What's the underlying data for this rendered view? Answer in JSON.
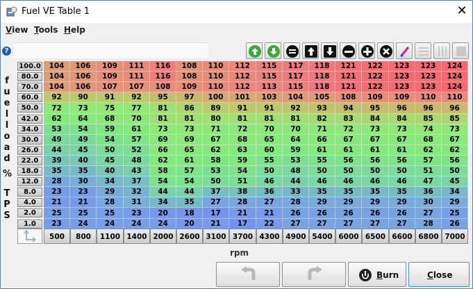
{
  "window": {
    "title": "Fuel VE Table 1",
    "close_glyph": "✕"
  },
  "menu": [
    {
      "label": "View",
      "ul": "V",
      "rest": "iew"
    },
    {
      "label": "Tools",
      "ul": "T",
      "rest": "ools"
    },
    {
      "label": "Help",
      "ul": "H",
      "rest": "elp"
    }
  ],
  "help_glyph": "?",
  "toolbar": {
    "buttons": [
      "increment-icon",
      "decrement-icon",
      "set-value-icon",
      "shift-up-icon",
      "shift-down-icon",
      "subtract-icon",
      "add-icon",
      "multiply-icon",
      "pen-icon",
      "vertical-interpolate-icon",
      "horizontal-interpolate-icon",
      "fill-icon"
    ]
  },
  "side_label": {
    "top": [
      "f",
      "u",
      "e",
      "l",
      "l",
      "o",
      "a",
      "d"
    ],
    "mid": "%",
    "bottom": [
      "T",
      "P",
      "S"
    ]
  },
  "table": {
    "y_axis": [
      "100.0",
      "80.0",
      "70.0",
      "60.0",
      "50.0",
      "42.0",
      "34.0",
      "30.0",
      "26.0",
      "22.0",
      "18.0",
      "12.0",
      "8.0",
      "4.0",
      "2.0",
      "1.0"
    ],
    "x_axis": [
      "500",
      "800",
      "1100",
      "1400",
      "2000",
      "2600",
      "3100",
      "3700",
      "4300",
      "4900",
      "5400",
      "6000",
      "6500",
      "6600",
      "6800",
      "7000"
    ],
    "x_axis_title": "rpm",
    "rows": [
      [
        104,
        106,
        109,
        111,
        116,
        108,
        110,
        112,
        115,
        117,
        118,
        121,
        122,
        123,
        123,
        124
      ],
      [
        104,
        106,
        109,
        111,
        116,
        108,
        110,
        112,
        115,
        117,
        118,
        121,
        122,
        123,
        123,
        124
      ],
      [
        104,
        106,
        107,
        107,
        108,
        109,
        110,
        112,
        113,
        115,
        118,
        121,
        122,
        123,
        123,
        124
      ],
      [
        92,
        90,
        91,
        92,
        95,
        97,
        100,
        101,
        103,
        104,
        105,
        108,
        109,
        109,
        110,
        110
      ],
      [
        72,
        73,
        75,
        77,
        81,
        86,
        89,
        91,
        91,
        92,
        93,
        94,
        95,
        96,
        96,
        96
      ],
      [
        62,
        64,
        68,
        70,
        81,
        81,
        80,
        81,
        81,
        81,
        82,
        83,
        84,
        84,
        85,
        85
      ],
      [
        53,
        54,
        59,
        61,
        73,
        73,
        71,
        72,
        70,
        70,
        71,
        72,
        73,
        73,
        74,
        73
      ],
      [
        49,
        49,
        54,
        57,
        69,
        69,
        67,
        68,
        65,
        64,
        66,
        67,
        67,
        67,
        68,
        67
      ],
      [
        44,
        45,
        50,
        52,
        66,
        65,
        62,
        63,
        60,
        59,
        61,
        61,
        61,
        61,
        62,
        62
      ],
      [
        39,
        40,
        45,
        48,
        62,
        61,
        58,
        59,
        55,
        53,
        55,
        56,
        56,
        56,
        57,
        56
      ],
      [
        35,
        35,
        40,
        43,
        58,
        57,
        53,
        54,
        50,
        48,
        50,
        50,
        50,
        50,
        51,
        50
      ],
      [
        28,
        30,
        34,
        37,
        54,
        54,
        50,
        51,
        46,
        44,
        46,
        46,
        46,
        46,
        47,
        45
      ],
      [
        23,
        23,
        29,
        32,
        44,
        44,
        37,
        38,
        36,
        33,
        35,
        35,
        35,
        35,
        36,
        34
      ],
      [
        21,
        21,
        28,
        31,
        34,
        35,
        27,
        28,
        27,
        28,
        29,
        29,
        29,
        29,
        30,
        29
      ],
      [
        25,
        25,
        25,
        23,
        20,
        18,
        17,
        21,
        21,
        26,
        26,
        26,
        26,
        26,
        27,
        25
      ],
      [
        23,
        24,
        24,
        24,
        24,
        20,
        21,
        17,
        22,
        27,
        27,
        27,
        27,
        27,
        28,
        26
      ]
    ]
  },
  "buttons": {
    "undo_icon": "undo-icon",
    "redo_icon": "redo-icon",
    "burn_label": "Burn",
    "burn_ul": "B",
    "burn_rest": "urn",
    "close_label": "Close",
    "close_ul": "C",
    "close_rest": "lose"
  }
}
